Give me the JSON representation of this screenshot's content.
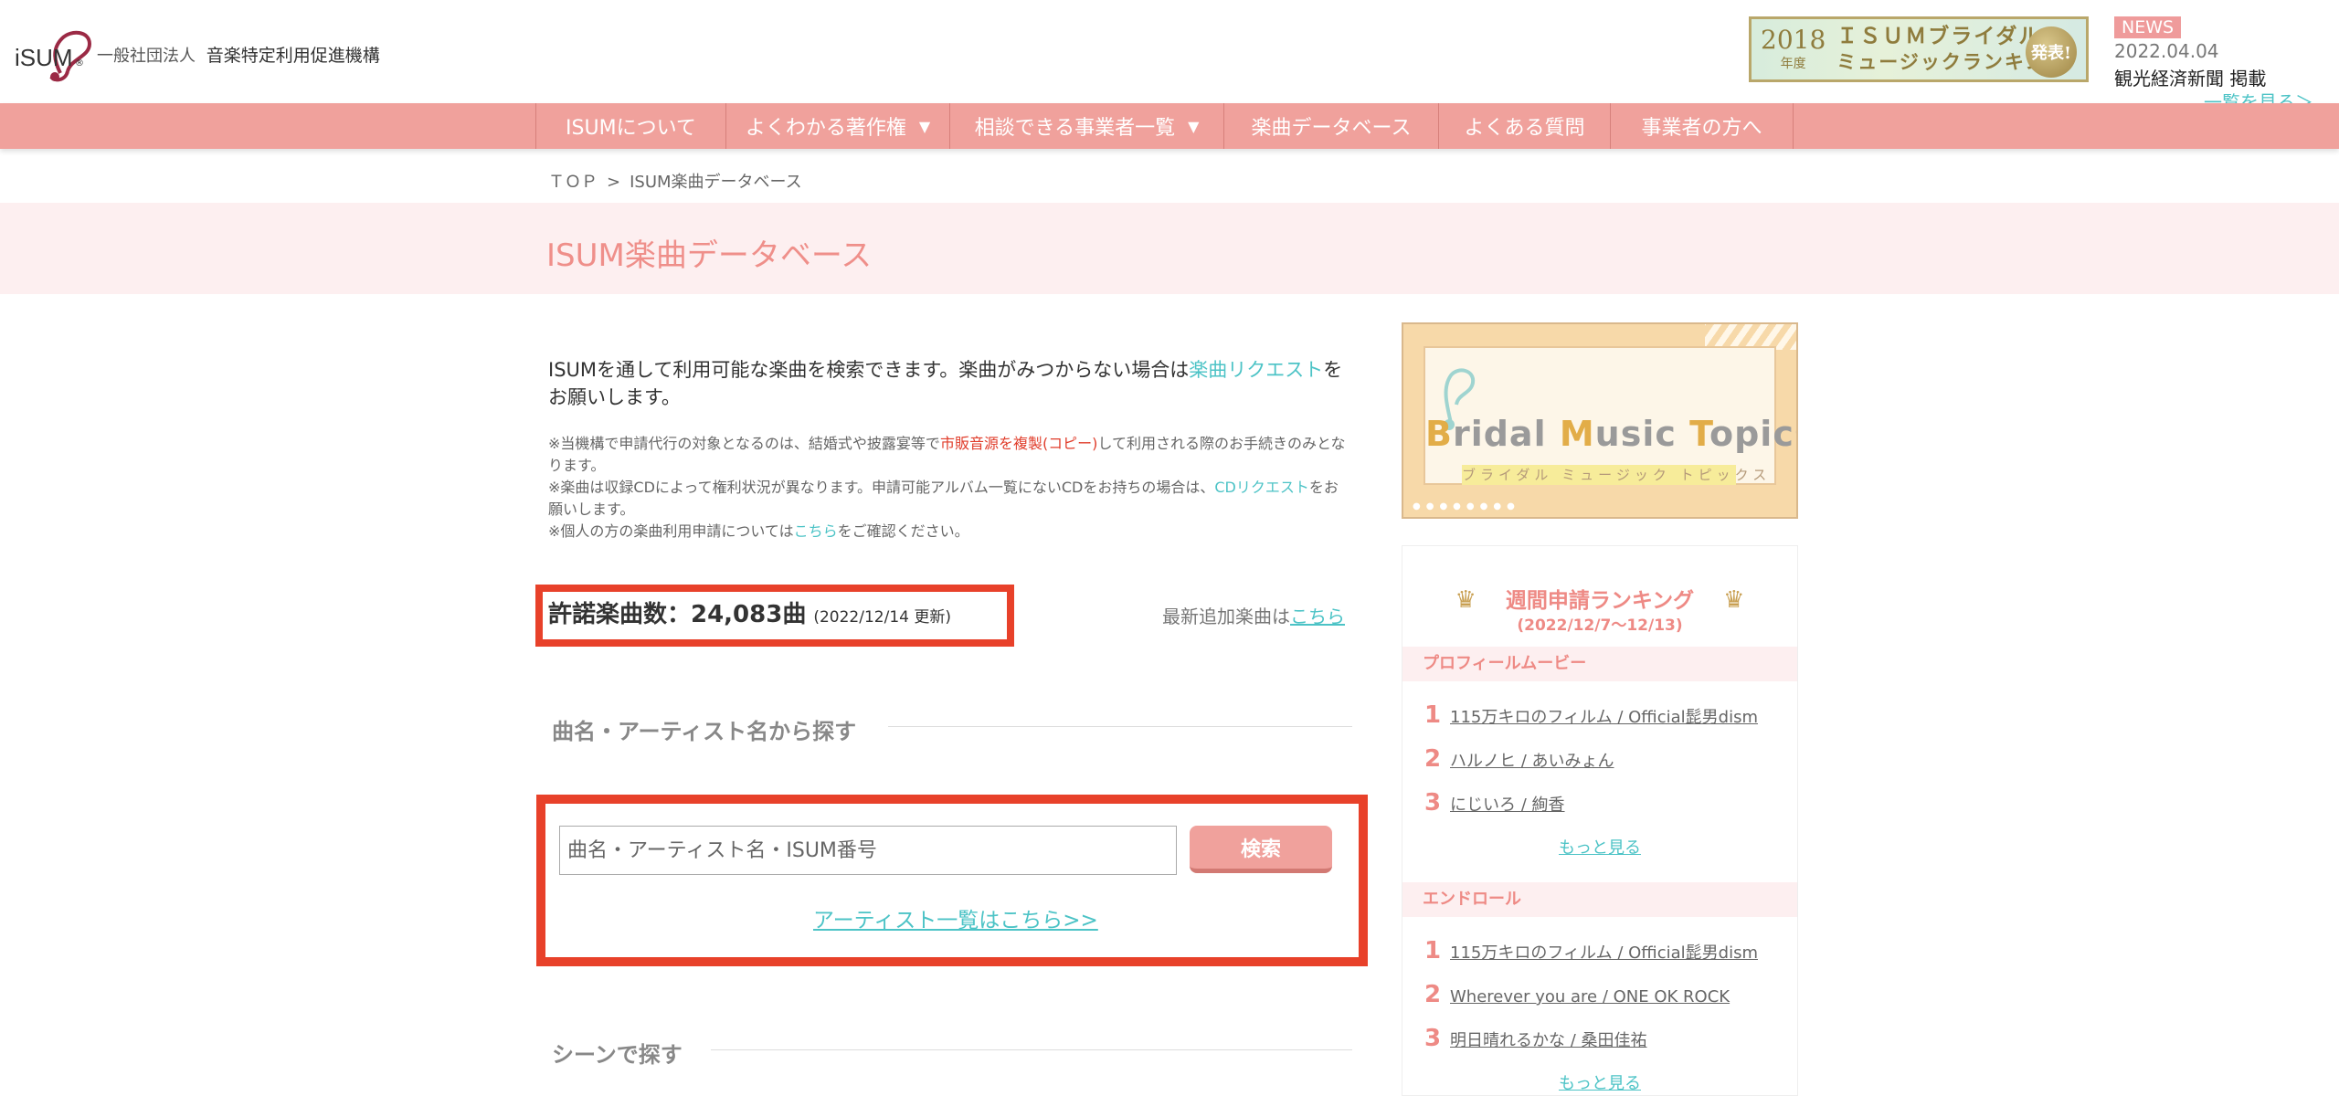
{
  "header": {
    "logo_text": "iSUM",
    "org_prefix": "一般社団法人",
    "org_name": "音楽特定利用促進機構",
    "banner": {
      "year": "2018",
      "year_suffix": "年度",
      "line1": "ＩＳＵＭブライダル",
      "line2": "ミュージックランキング",
      "badge": "発表!"
    },
    "news": {
      "tag": "NEWS",
      "date": "2022.04.04",
      "title": "観光経済新聞 掲載",
      "more": "一覧を見る＞"
    }
  },
  "nav": {
    "items": [
      {
        "label": "ISUMについて"
      },
      {
        "label": "よくわかる著作権"
      },
      {
        "label": "相談できる事業者一覧"
      },
      {
        "label": "楽曲データベース"
      },
      {
        "label": "よくある質問"
      },
      {
        "label": "事業者の方へ"
      }
    ],
    "caret": "▼"
  },
  "breadcrumb": {
    "home": "ＴＯＰ",
    "sep": ">",
    "current": "ISUM楽曲データベース"
  },
  "page": {
    "title": "ISUM楽曲データベース"
  },
  "intro": {
    "text_before": "ISUMを通して利用可能な楽曲を検索できます。楽曲がみつからない場合は",
    "request_link": "楽曲リクエスト",
    "text_after": "をお願いします。"
  },
  "notes": {
    "n1_before": "※当機構で申請代行の対象となるのは、結婚式や披露宴等で",
    "n1_red": "市販音源を複製(コピー)",
    "n1_after": "して利用される際のお手続きのみとなります。",
    "n2_before": "※楽曲は収録CDによって権利状況が異なります。申請可能アルバム一覧にないCDをお持ちの場合は、",
    "n2_link": "CDリクエスト",
    "n2_after": "をお願いします。",
    "n3_before": "※個人の方の楽曲利用申請については",
    "n3_link": "こちら",
    "n3_after": "をご確認ください。"
  },
  "count": {
    "label": "許諾楽曲数：24,083曲",
    "updated": "(2022/12/14 更新)",
    "latest_text": "最新追加楽曲は",
    "latest_link": "こちら"
  },
  "search": {
    "heading": "曲名・アーティスト名から探す",
    "placeholder": "曲名・アーティスト名・ISUM番号",
    "button": "検索",
    "artist_link": "アーティスト一覧はこちら>>"
  },
  "scene": {
    "heading": "シーンで探す"
  },
  "sidebar": {
    "bmt": {
      "title_b": "B",
      "title_1": "ridal ",
      "title_m": "M",
      "title_2": "usic ",
      "title_t": "T",
      "title_3": "opics",
      "subtitle": "ブライダル ミュージック トピックス"
    },
    "ranking": {
      "crown": "♛",
      "title": "週間申請ランキング",
      "dates": "(2022/12/7〜12/13)",
      "categories": [
        {
          "name": "プロフィールムービー",
          "items": [
            {
              "rank": "1",
              "song": "115万キロのフィルム / Official髭男dism"
            },
            {
              "rank": "2",
              "song": "ハルノヒ / あいみょん"
            },
            {
              "rank": "3",
              "song": "にじいろ / 絢香"
            }
          ],
          "more": "もっと見る"
        },
        {
          "name": "エンドロール",
          "items": [
            {
              "rank": "1",
              "song": "115万キロのフィルム / Official髭男dism"
            },
            {
              "rank": "2",
              "song": "Wherever you are / ONE OK ROCK"
            },
            {
              "rank": "3",
              "song": "明日晴れるかな / 桑田佳祐"
            }
          ],
          "more": "もっと見る"
        }
      ]
    }
  },
  "colors": {
    "nav_pink": "#f0a19c",
    "title_pink": "#ef8f8a",
    "link_teal": "#4cc3c6",
    "highlight_red": "#e8412a"
  }
}
